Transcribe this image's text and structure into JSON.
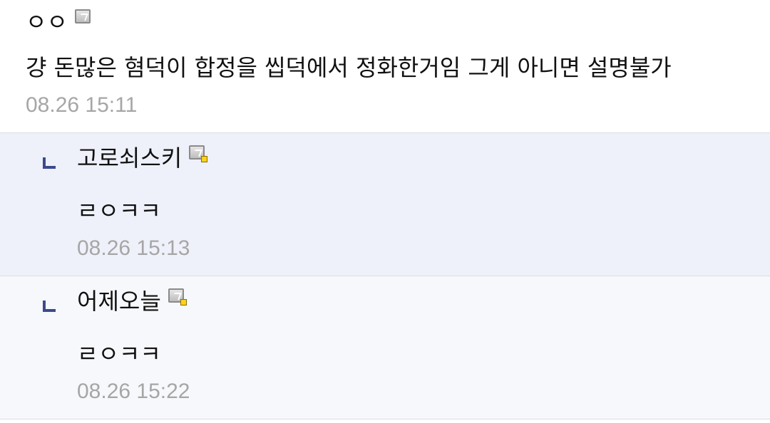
{
  "comments": [
    {
      "author": "ㅇㅇ",
      "text": "걍 돈많은 혐덕이 합정을 씹덕에서 정화한거임 그게 아니면 설명불가",
      "time": "08.26 15:11"
    },
    {
      "author": "고로쇠스키",
      "text": "ㄹㅇㅋㅋ",
      "time": "08.26 15:13"
    },
    {
      "author": "어제오늘",
      "text": "ㄹㅇㅋㅋ",
      "time": "08.26 15:22"
    }
  ],
  "icons": {
    "member": "member-badge-icon",
    "reply": "reply-arrow-icon"
  },
  "colors": {
    "reply_bg": "#eef1fa",
    "reply2_bg": "#f7f8fb",
    "timestamp": "#a6a6a6",
    "reply_arrow": "#3a4a8c"
  }
}
